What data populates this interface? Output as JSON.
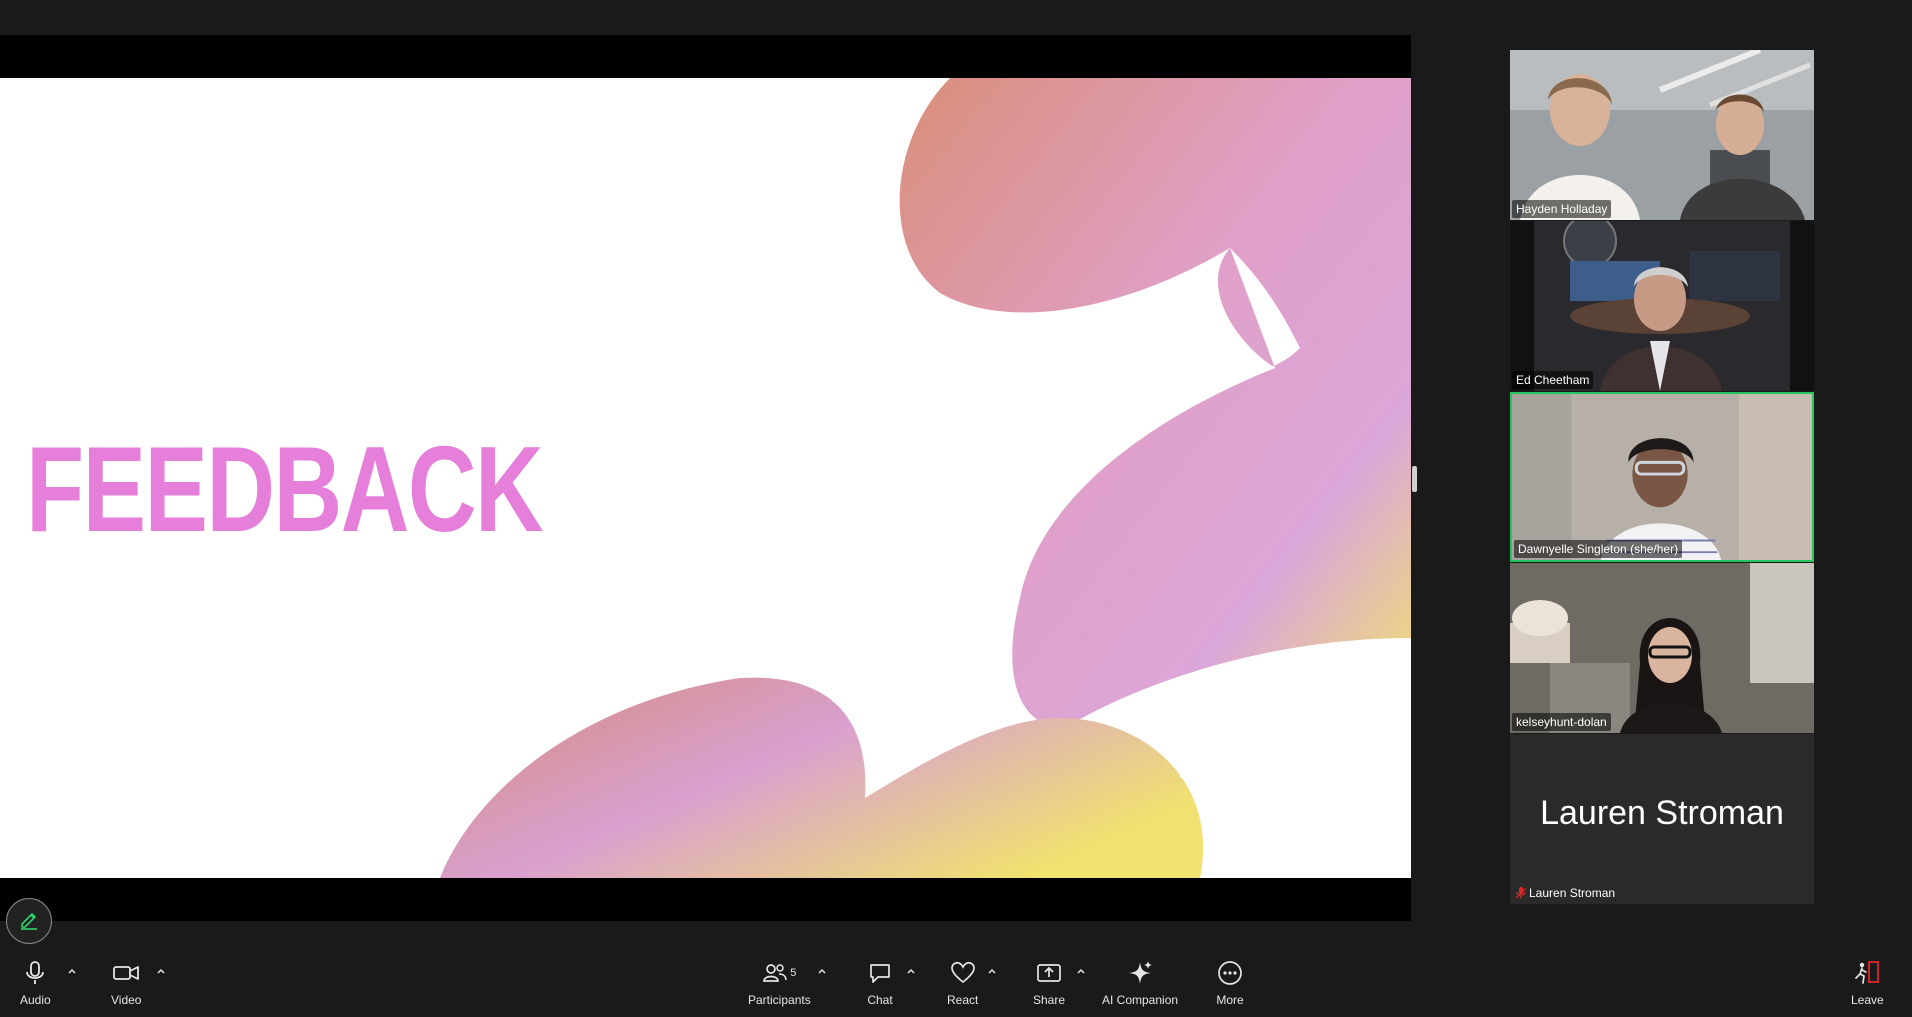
{
  "slide": {
    "title": "FEEDBACK"
  },
  "participants": [
    {
      "name": "Hayden Holladay",
      "active": false
    },
    {
      "name": "Ed Cheetham",
      "active": false
    },
    {
      "name": "Dawnyelle Singleton (she/her)",
      "active": true
    },
    {
      "name": "kelseyhunt-dolan",
      "active": false
    },
    {
      "name": "Lauren Stroman",
      "avatar_text": "Lauren Stroman",
      "muted": true
    }
  ],
  "toolbar": {
    "audio": "Audio",
    "video": "Video",
    "participants": "Participants",
    "participants_count": "5",
    "chat": "Chat",
    "react": "React",
    "share": "Share",
    "ai_companion": "AI Companion",
    "more": "More",
    "leave": "Leave"
  },
  "colors": {
    "accent_active": "#22c55e",
    "title_pink": "#e57fd9",
    "leave_red": "#e02828"
  }
}
